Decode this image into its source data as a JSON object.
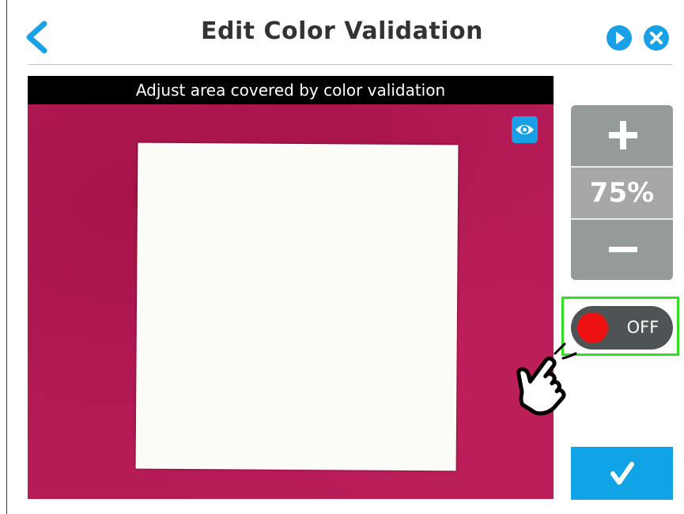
{
  "header": {
    "title": "Edit Color Validation",
    "back_icon": "chevron-left-icon",
    "play_icon": "play-icon",
    "close_icon": "close-icon",
    "accent_color": "#1aa0e6"
  },
  "camera_view": {
    "banner_text": "Adjust area covered by color validation",
    "background_color": "#b51b55",
    "visibility_icon": "eye-icon"
  },
  "zoom": {
    "increase_icon": "plus-icon",
    "value": "75%",
    "decrease_icon": "minus-icon"
  },
  "toggle": {
    "state_label": "OFF",
    "knob_color": "#ee1111",
    "highlight_color": "#33dd22"
  },
  "pointer": {
    "icon": "hand-pointer-icon"
  },
  "confirm": {
    "icon": "checkmark-icon"
  }
}
